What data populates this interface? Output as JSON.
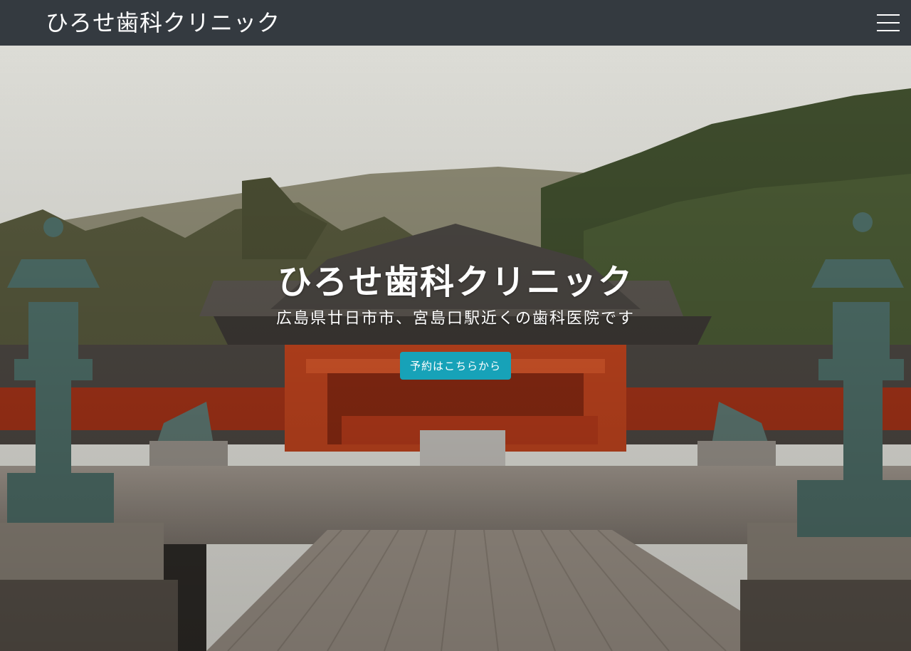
{
  "navbar": {
    "brand": "ひろせ歯科クリニック",
    "menu_icon": "hamburger-menu-icon"
  },
  "hero": {
    "title": "ひろせ歯科クリニック",
    "subtitle": "広島県廿日市市、宮島口駅近くの歯科医院です",
    "cta_label": "予約はこちらから"
  },
  "colors": {
    "navbar_bg": "#343a40",
    "cta_bg": "#17a2b8",
    "text": "#ffffff"
  }
}
